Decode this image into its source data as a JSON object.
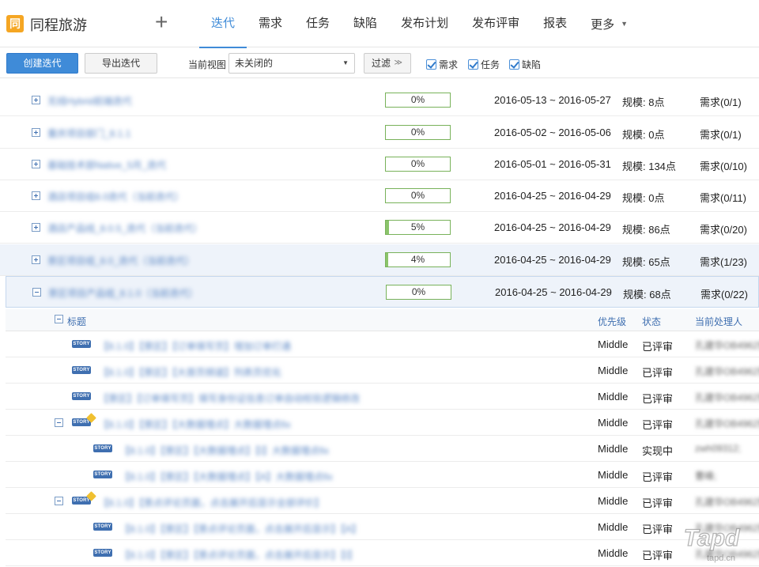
{
  "header": {
    "logo_char": "同",
    "project_name": "同程旅游",
    "nav": [
      {
        "label": "迭代",
        "active": true
      },
      {
        "label": "需求"
      },
      {
        "label": "任务"
      },
      {
        "label": "缺陷"
      },
      {
        "label": "发布计划"
      },
      {
        "label": "发布评审"
      },
      {
        "label": "报表"
      },
      {
        "label": "更多"
      }
    ]
  },
  "toolbar": {
    "create_label": "创建迭代",
    "export_label": "导出迭代",
    "view_label": "当前视图",
    "view_value": "未关闭的",
    "filter_label": "过滤",
    "checks": [
      {
        "label": "需求",
        "checked": true
      },
      {
        "label": "任务",
        "checked": true
      },
      {
        "label": "缺陷",
        "checked": true
      }
    ]
  },
  "iterations": [
    {
      "name": "无线Hybrid前端迭代",
      "progress": "0%",
      "progress_value": 0,
      "dates": "2016-05-13 ~ 2016-05-27",
      "scale": "规模: 8点",
      "req": "需求(0/1)"
    },
    {
      "name": "重庆项目部门_8.1.1",
      "progress": "0%",
      "progress_value": 0,
      "dates": "2016-05-02 ~ 2016-05-06",
      "scale": "规模: 0点",
      "req": "需求(0/1)"
    },
    {
      "name": "基础技术部Native_5月_迭代",
      "progress": "0%",
      "progress_value": 0,
      "dates": "2016-05-01 ~ 2016-05-31",
      "scale": "规模: 134点",
      "req": "需求(0/10)"
    },
    {
      "name": "酒店项目组8.0迭代（当前迭代）",
      "progress": "0%",
      "progress_value": 0,
      "dates": "2016-04-25 ~ 2016-04-29",
      "scale": "规模: 0点",
      "req": "需求(0/11)"
    },
    {
      "name": "酒店产品线_8.0.5_迭代（当前迭代）",
      "progress": "5%",
      "progress_value": 5,
      "dates": "2016-04-25 ~ 2016-04-29",
      "scale": "规模: 86点",
      "req": "需求(0/20)"
    },
    {
      "name": "景区项目组_8.0_迭代（当前迭代）",
      "progress": "4%",
      "progress_value": 4,
      "dates": "2016-04-25 ~ 2016-04-29",
      "scale": "规模: 65点",
      "req": "需求(1/23)"
    },
    {
      "name": "景区项目产品组_8.1.0（当前迭代）",
      "progress": "0%",
      "progress_value": 0,
      "dates": "2016-04-25 ~ 2016-04-29",
      "scale": "规模: 68点",
      "req": "需求(0/22)"
    }
  ],
  "story_table": {
    "col_title": "标题",
    "col_priority": "优先级",
    "col_status": "状态",
    "col_owner": "当前处理人",
    "badge": "STORY",
    "rows": [
      {
        "title": "【8.1.0】【景区】【订单填写页】增加订单打通",
        "priority": "Middle",
        "status": "已评审",
        "owner": "孔建华OB4962曹"
      },
      {
        "title": "【8.1.0】【景区】【大首页频道】列表页优化",
        "priority": "Middle",
        "status": "已评审",
        "owner": "孔建华OB4962曹"
      },
      {
        "title": "【景区】【订单填写页】填写身份证信息订单自动校验逻辑修改",
        "priority": "Middle",
        "status": "已评审",
        "owner": "孔建华OB4962曹"
      },
      {
        "title": "【8.1.0】【景区】【大数据埋点】大数据埋点fix",
        "priority": "Middle",
        "status": "已评审",
        "owner": "孔建华OB4962曹"
      },
      {
        "title": "【8.1.0】【景区】【大数据埋点】【I】大数据埋点fix",
        "priority": "Middle",
        "status": "实现中",
        "owner": "zwh09312;"
      },
      {
        "title": "【8.1.0】【景区】【大数据埋点】【A】大数据埋点fix",
        "priority": "Middle",
        "status": "已评审",
        "owner": "曹峰;"
      },
      {
        "title": "【8.1.0】【景点评论页面，点击展开后显示全部评价】",
        "priority": "Middle",
        "status": "已评审",
        "owner": "孔建华OB4962曹"
      },
      {
        "title": "【8.1.0】【景区】【景点评论页面，点击展开后显示】【A】",
        "priority": "Middle",
        "status": "已评审",
        "owner": "孔建华OB4962曹"
      },
      {
        "title": "【8.1.0】【景区】【景点评论页面，点击展开后显示】【I】",
        "priority": "Middle",
        "status": "已评审",
        "owner": "孔建华OB4962曹"
      }
    ]
  },
  "watermark": {
    "main": "Tapd",
    "sub": "tapd.cn"
  },
  "colors": {
    "accent": "#3f8bd8",
    "logo": "#f5a623",
    "progress": "#8bc46b",
    "link": "#5a86c4"
  }
}
